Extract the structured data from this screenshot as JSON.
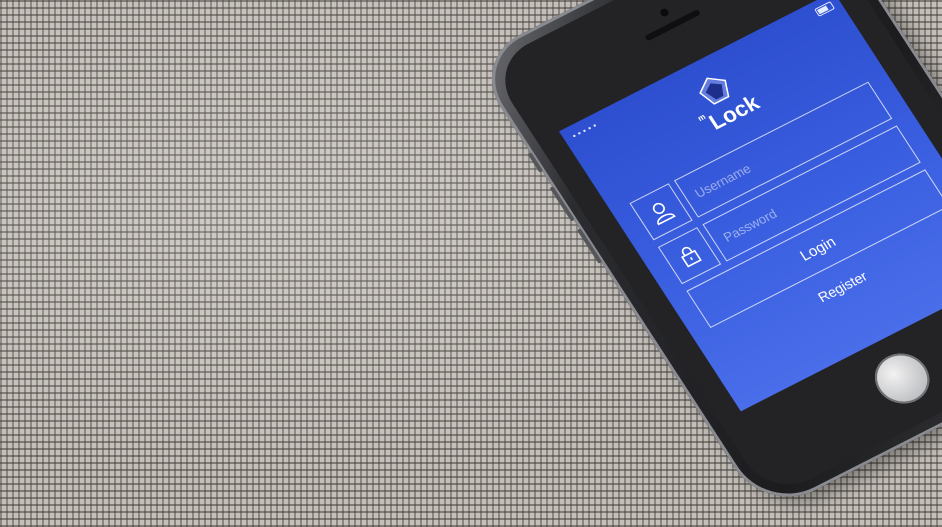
{
  "scene": {
    "background": "woven mesh fabric surface"
  },
  "app": {
    "logo": {
      "superscript": "m",
      "name": "Lock",
      "icon": "diamond-pin-icon"
    },
    "username_field": {
      "icon": "user-icon",
      "placeholder": "Username",
      "value": ""
    },
    "password_field": {
      "icon": "padlock-icon",
      "placeholder": "Password",
      "value": ""
    },
    "login_label": "Login",
    "register_label": "Register"
  },
  "colors": {
    "screen_blue": "#3356d8",
    "phone_body": "#232326",
    "text": "#ffffff"
  }
}
